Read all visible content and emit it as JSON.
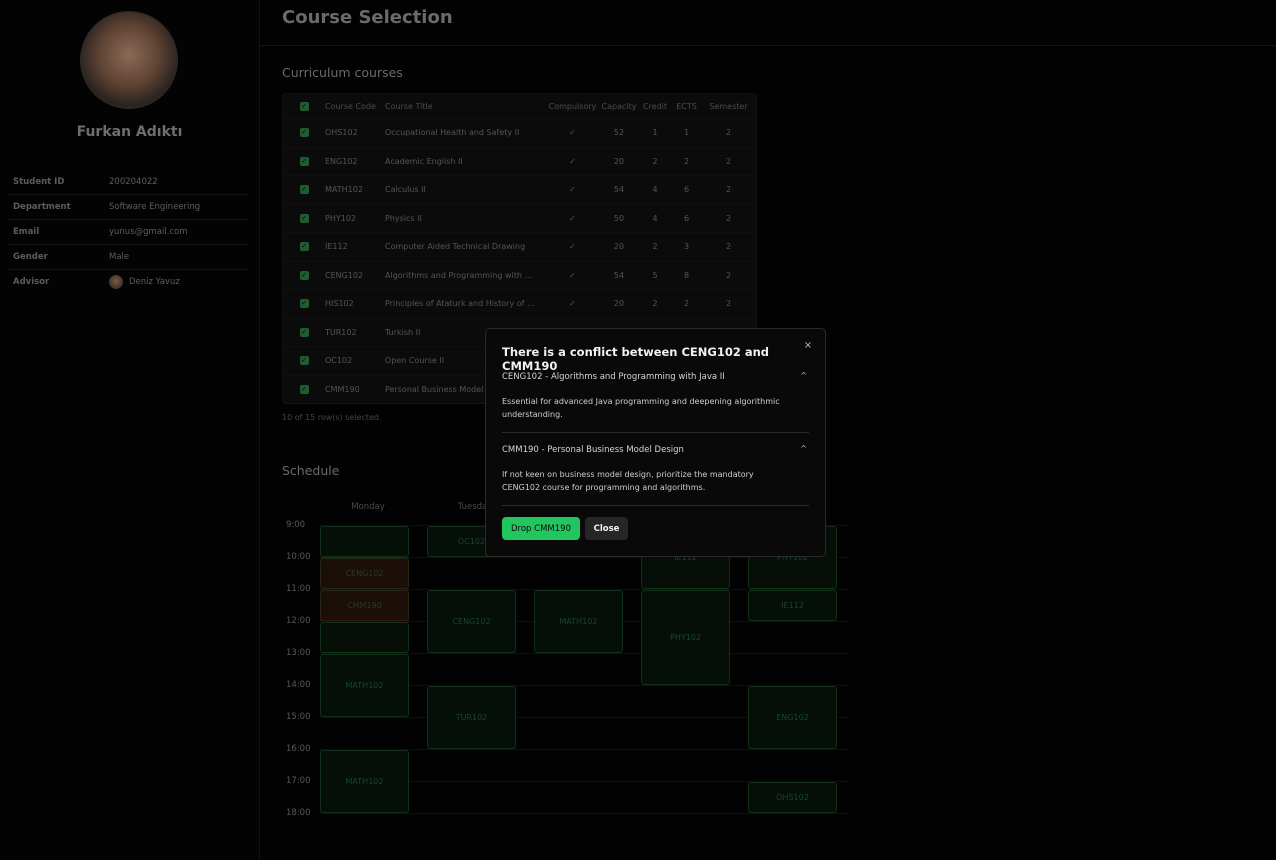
{
  "page": {
    "title": "Course Selection"
  },
  "profile": {
    "name": "Furkan Adıktı",
    "info": [
      {
        "key": "Student ID",
        "value": "200204022"
      },
      {
        "key": "Department",
        "value": "Software Engineering"
      },
      {
        "key": "Email",
        "value": "yunus@gmail.com"
      },
      {
        "key": "Gender",
        "value": "Male"
      },
      {
        "key": "Advisor",
        "value": "Deniz Yavuz"
      }
    ]
  },
  "curriculum": {
    "title": "Curriculum courses",
    "columns": [
      "Course Code",
      "Course Title",
      "Compulsory",
      "Capacity",
      "Credit",
      "ECTS",
      "Semester"
    ],
    "rows": [
      {
        "code": "OHS102",
        "title": "Occupational Health and Safety II",
        "compulsory": "✓",
        "capacity": "52",
        "credit": "1",
        "ects": "1",
        "semester": "2"
      },
      {
        "code": "ENG102",
        "title": "Academic English II",
        "compulsory": "✓",
        "capacity": "20",
        "credit": "2",
        "ects": "2",
        "semester": "2"
      },
      {
        "code": "MATH102",
        "title": "Calculus II",
        "compulsory": "✓",
        "capacity": "54",
        "credit": "4",
        "ects": "6",
        "semester": "2"
      },
      {
        "code": "PHY102",
        "title": "Physics II",
        "compulsory": "✓",
        "capacity": "50",
        "credit": "4",
        "ects": "6",
        "semester": "2"
      },
      {
        "code": "IE112",
        "title": "Computer Aided Technical Drawing",
        "compulsory": "✓",
        "capacity": "20",
        "credit": "2",
        "ects": "3",
        "semester": "2"
      },
      {
        "code": "CENG102",
        "title": "Algorithms and Programming with ...",
        "compulsory": "✓",
        "capacity": "54",
        "credit": "5",
        "ects": "8",
        "semester": "2"
      },
      {
        "code": "HIS102",
        "title": "Principles of Ataturk and History of ...",
        "compulsory": "✓",
        "capacity": "20",
        "credit": "2",
        "ects": "2",
        "semester": "2"
      },
      {
        "code": "TUR102",
        "title": "Turkish II",
        "compulsory": "✓",
        "capacity": "20",
        "credit": "2",
        "ects": "2",
        "semester": "2"
      },
      {
        "code": "OC102",
        "title": "Open Course II",
        "compulsory": "",
        "capacity": "",
        "credit": "",
        "ects": "",
        "semester": ""
      },
      {
        "code": "CMM190",
        "title": "Personal Business Model ...",
        "compulsory": "",
        "capacity": "",
        "credit": "",
        "ects": "",
        "semester": ""
      }
    ],
    "selected_text": "10 of 15 row(s) selected."
  },
  "schedule": {
    "title": "Schedule",
    "days": [
      "Monday",
      "Tuesday"
    ],
    "times": [
      "9:00",
      "10:00",
      "11:00",
      "12:00",
      "13:00",
      "14:00",
      "15:00",
      "16:00",
      "17:00",
      "18:00"
    ],
    "blocks": [
      {
        "label": "",
        "col": 0,
        "start": 9.0,
        "end": 10.0
      },
      {
        "label": "CENG102",
        "col": 0,
        "start": 10.0,
        "end": 11.0
      },
      {
        "label": "CMM190",
        "col": 0,
        "start": 11.0,
        "end": 12.0
      },
      {
        "label": "",
        "col": 0,
        "start": 12.0,
        "end": 13.0
      },
      {
        "label": "MATH102",
        "col": 0,
        "start": 13.0,
        "end": 15.0
      },
      {
        "label": "MATH102",
        "col": 0,
        "start": 16.0,
        "end": 18.0
      },
      {
        "label": "OC102",
        "col": 1,
        "start": 9.0,
        "end": 10.0
      },
      {
        "label": "CENG102",
        "col": 1,
        "start": 11.0,
        "end": 13.0
      },
      {
        "label": "TUR102",
        "col": 1,
        "start": 14.0,
        "end": 16.0
      },
      {
        "label": "MATH102",
        "col": 2,
        "start": 11.0,
        "end": 13.0
      },
      {
        "label": "IE112",
        "col": 3,
        "start": 9.0,
        "end": 11.0
      },
      {
        "label": "PHY102",
        "col": 3,
        "start": 11.0,
        "end": 14.0
      },
      {
        "label": "PHY102",
        "col": 4,
        "start": 9.0,
        "end": 11.0
      },
      {
        "label": "IE112",
        "col": 4,
        "start": 11.0,
        "end": 12.0
      },
      {
        "label": "ENG102",
        "col": 4,
        "start": 14.0,
        "end": 16.0
      },
      {
        "label": "OHS102",
        "col": 4,
        "start": 17.0,
        "end": 18.0
      }
    ]
  },
  "dialog": {
    "title": "There is a conflict between CENG102 and CMM190",
    "close_icon": "×",
    "chevron": "^",
    "items": [
      {
        "heading": "CENG102 - Algorithms and Programming with Java II",
        "body": "Essential for advanced Java programming and deepening algorithmic understanding."
      },
      {
        "heading": "CMM190 - Personal Business Model Design",
        "body": "If not keen on business model design, prioritize the mandatory CENG102 course for programming and algorithms."
      }
    ],
    "drop_label": "Drop CMM190",
    "close_label": "Close"
  }
}
